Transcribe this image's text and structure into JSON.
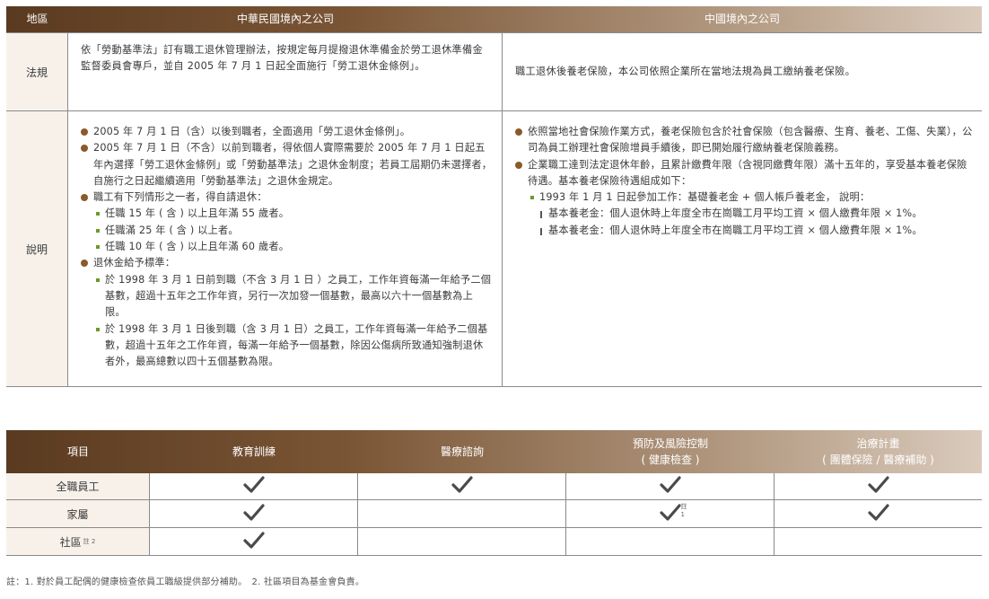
{
  "table1": {
    "header": {
      "region": "地區",
      "taiwan": "中華民國境內之公司",
      "china": "中國境內之公司"
    },
    "rows": [
      {
        "label": "法規",
        "taiwan_text": "依「勞動基準法」訂有職工退休管理辦法，按規定每月提撥退休準備金於勞工退休準備金監督委員會專戶，並自 2005 年 7 月 1 日起全面施行「勞工退休金條例」。",
        "china_text": "職工退休後養老保險，本公司依照企業所在當地法規為員工繳納養老保險。"
      },
      {
        "label": "說明",
        "taiwan_items": [
          {
            "text": "2005 年 7 月 1 日（含）以後到職者，全面適用「勞工退休金條例」。"
          },
          {
            "text": "2005 年 7 月 1 日（不含）以前到職者，得依個人實際需要於 2005 年 7 月 1 日起五年內選擇「勞工退休金條例」或「勞動基準法」之退休金制度；若員工屆期仍未選擇者， 自施行之日起繼續適用「勞動基準法」之退休金規定。"
          },
          {
            "text": "職工有下列情形之一者，得自請退休：",
            "sub": [
              "任職 15 年 ( 含 ) 以上且年滿 55 歲者。",
              "任職滿 25 年 ( 含 ) 以上者。",
              "任職 10 年 ( 含 ) 以上且年滿 60 歲者。"
            ]
          },
          {
            "text": "退休金給予標準：",
            "sub": [
              "於 1998 年 3 月 1 日前到職（不含 3 月 1 日 ）之員工，工作年資每滿一年給予二個基數，超過十五年之工作年資，另行一次加發一個基數，最高以六十一個基數為上限。",
              "於 1998 年 3 月 1 日後到職（含 3 月 1 日）之員工，工作年資每滿一年給予二個基數，超過十五年之工作年資，每滿一年給予一個基數，除因公傷病所致通知強制退休者外，最高總數以四十五個基數為限。"
            ]
          }
        ],
        "china_items": [
          {
            "text": "依照當地社會保險作業方式，養老保險包含於社會保險（包含醫療、生育、養老、工傷、失業），公司為員工辦理社會保險增員手續後，即已開始履行繳納養老保險義務。"
          },
          {
            "text": "企業職工達到法定退休年齡，且累計繳費年限（含視同繳費年限）滿十五年的，享受基本養老保險待遇。基本養老保險待遇組成如下：",
            "sub": [
              "1993 年 1 月 1 日起參加工作：基礎養老金 + 個人帳戶養老金， 說明："
            ],
            "subsub": [
              "基本養老金：個人退休時上年度全市在崗職工月平均工資 × 個人繳費年限 × 1%。",
              "基本養老金：個人退休時上年度全市在崗職工月平均工資 × 個人繳費年限 × 1%。"
            ]
          }
        ]
      }
    ]
  },
  "table2": {
    "header": {
      "item": "項目",
      "education": "教育訓練",
      "medical": "醫療諮詢",
      "prevention": "預防及風險控制",
      "prevention_sub": "( 健康檢查 )",
      "treatment": "治療計畫",
      "treatment_sub": "( 團體保險 / 醫療補助 )"
    },
    "rows": [
      {
        "label": "全職員工",
        "label_note": "",
        "education": true,
        "medical": true,
        "prevention": true,
        "prevention_note": "",
        "treatment": true
      },
      {
        "label": "家屬",
        "label_note": "",
        "education": true,
        "medical": false,
        "prevention": true,
        "prevention_note": "註 1",
        "treatment": true
      },
      {
        "label": "社區",
        "label_note": "註 2",
        "education": true,
        "medical": false,
        "prevention": false,
        "prevention_note": "",
        "treatment": false
      }
    ],
    "check_color": "#4a4a4a"
  },
  "footnote": "註：1. 對於員工配偶的健康檢查依員工職級提供部分補助。　2. 社區項目為基金會負責。",
  "colors": {
    "header_dark": "#5a3a20",
    "header_light": "#dacbbd",
    "label_bg": "#f7f1ea",
    "bullet": "#8a5a2a",
    "sub_bullet": "#6a9a2a"
  }
}
